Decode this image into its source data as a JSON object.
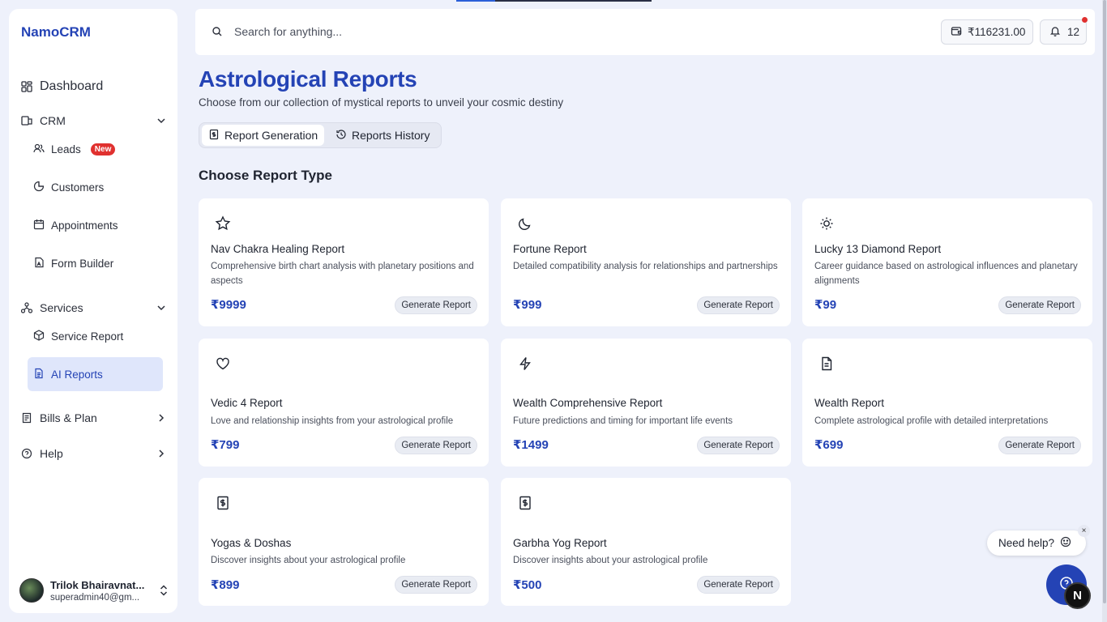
{
  "app": {
    "brand": "NamoCRM"
  },
  "sidebar": {
    "items": [
      {
        "label": "Dashboard"
      },
      {
        "label": "CRM"
      },
      {
        "label": "Leads",
        "badge": "New"
      },
      {
        "label": "Customers"
      },
      {
        "label": "Appointments"
      },
      {
        "label": "Form Builder"
      },
      {
        "label": "Services"
      },
      {
        "label": "Service Report"
      },
      {
        "label": "AI Reports"
      },
      {
        "label": "Bills & Plan"
      },
      {
        "label": "Help"
      }
    ],
    "user": {
      "name": "Trilok Bhairavnat...",
      "email": "superadmin40@gm..."
    }
  },
  "topbar": {
    "search_placeholder": "Search for anything...",
    "wallet_balance": "₹116231.00",
    "notification_count": "12"
  },
  "main": {
    "title": "Astrological Reports",
    "subtitle": "Choose from our collection of mystical reports to unveil your cosmic destiny",
    "tabs": [
      {
        "label": "Report Generation"
      },
      {
        "label": "Reports History"
      }
    ],
    "section_title": "Choose Report Type",
    "cards": [
      {
        "icon": "star-icon",
        "title": "Nav Chakra Healing Report",
        "desc": "Comprehensive birth chart analysis with planetary positions and aspects",
        "price": "₹9999",
        "button": "Generate Report"
      },
      {
        "icon": "moon-icon",
        "title": "Fortune Report",
        "desc": "Detailed compatibility analysis for relationships and partnerships",
        "price": "₹999",
        "button": "Generate Report"
      },
      {
        "icon": "sun-icon",
        "title": "Lucky 13 Diamond Report",
        "desc": "Career guidance based on astrological influences and planetary alignments",
        "price": "₹99",
        "button": "Generate Report"
      },
      {
        "icon": "heart-icon",
        "title": "Vedic 4 Report",
        "desc": "Love and relationship insights from your astrological profile",
        "price": "₹799",
        "button": "Generate Report"
      },
      {
        "icon": "lightning-icon",
        "title": "Wealth Comprehensive Report",
        "desc": "Future predictions and timing for important life events",
        "price": "₹1499",
        "button": "Generate Report"
      },
      {
        "icon": "document-icon",
        "title": "Wealth Report",
        "desc": "Complete astrological profile with detailed interpretations",
        "price": "₹699",
        "button": "Generate Report"
      },
      {
        "icon": "receipt-icon",
        "title": "Yogas & Doshas",
        "desc": "Discover insights about your astrological profile",
        "price": "₹899",
        "button": "Generate Report"
      },
      {
        "icon": "receipt-icon",
        "title": "Garbha Yog Report",
        "desc": "Discover insights about your astrological profile",
        "price": "₹500",
        "button": "Generate Report"
      }
    ]
  },
  "help_widget": {
    "label": "Need help?",
    "close": "×",
    "badge": "N"
  },
  "colors": {
    "accent": "#2443b5",
    "badge": "#e0312f",
    "background": "#eef1fb"
  }
}
